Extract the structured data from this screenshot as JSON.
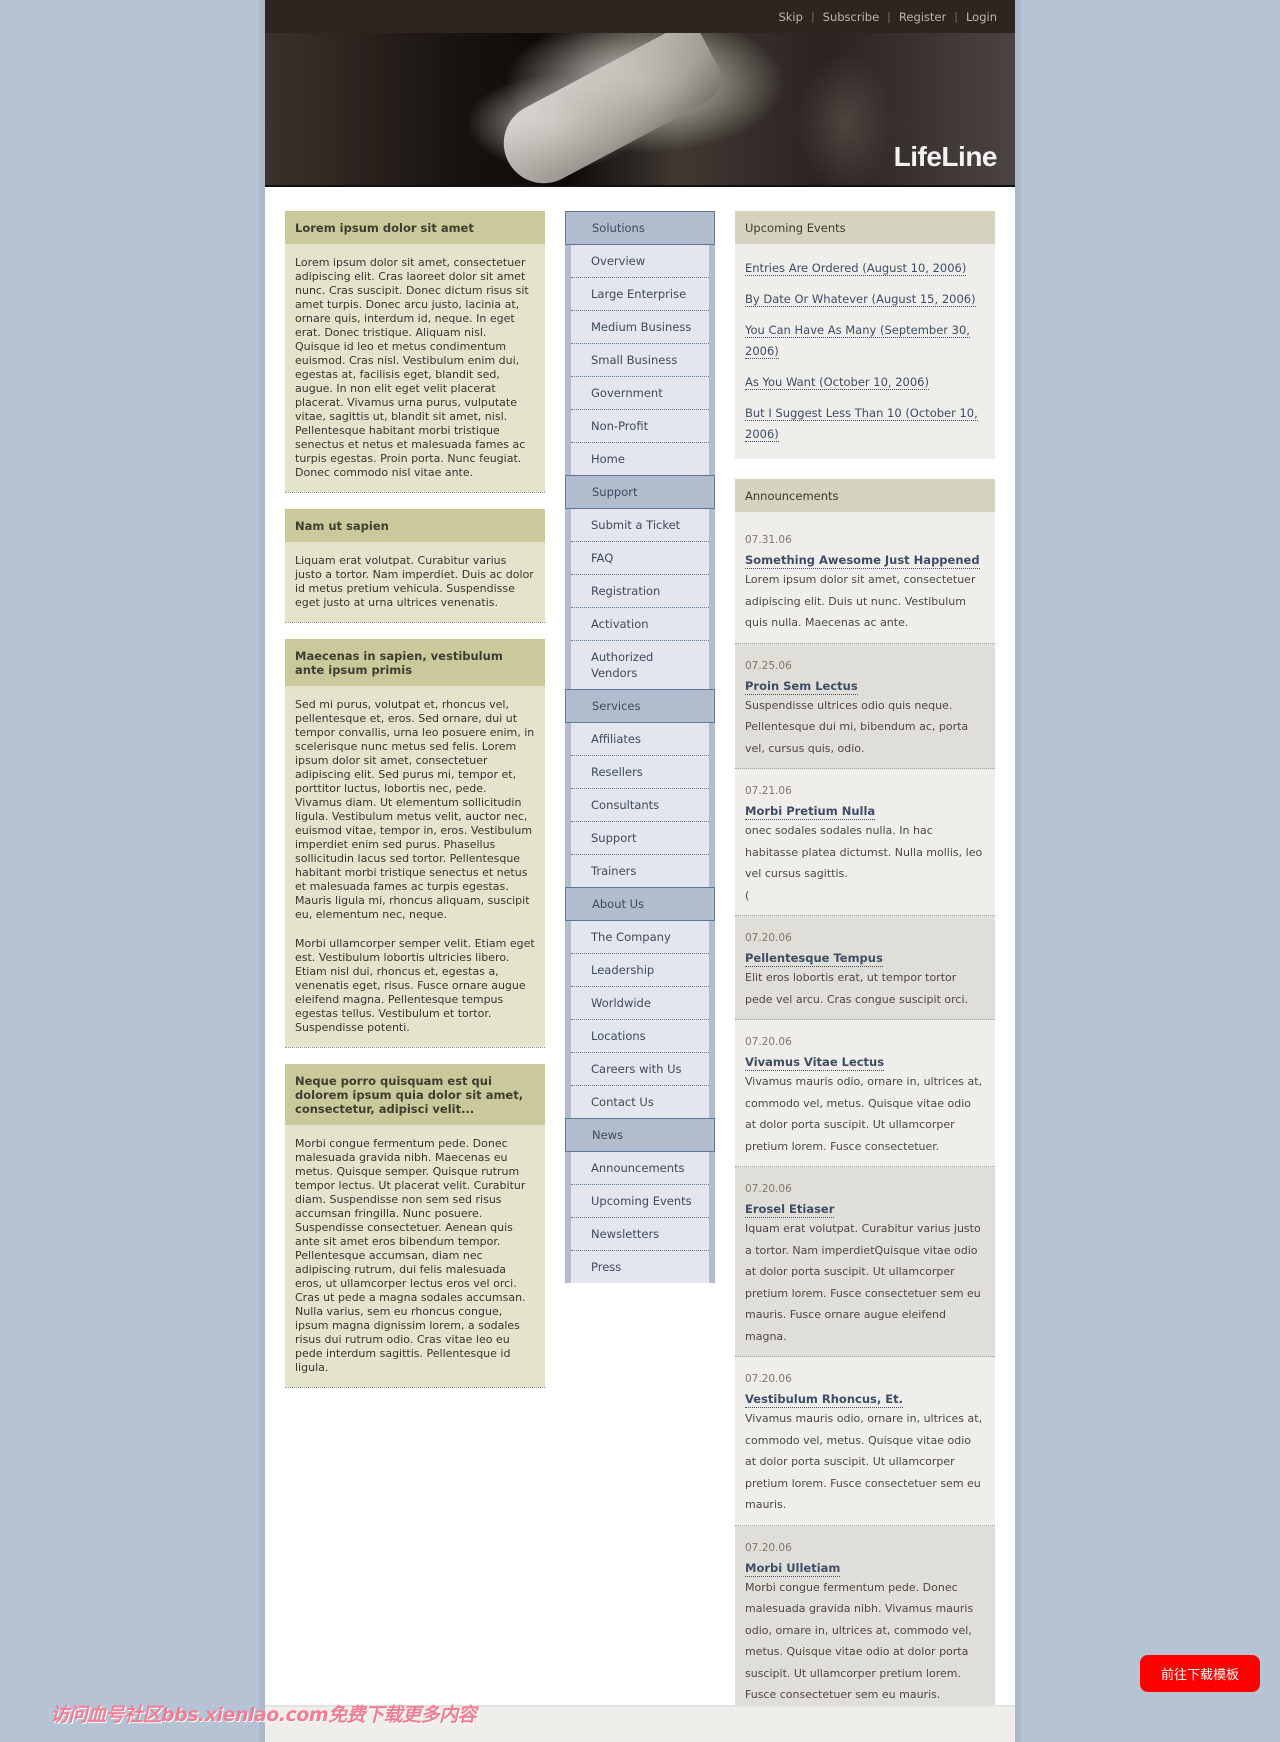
{
  "topbar": {
    "links": [
      "Skip",
      "Subscribe",
      "Register",
      "Login"
    ]
  },
  "banner": {
    "title": "LifeLine"
  },
  "left_boxes": [
    {
      "title": "Lorem ipsum dolor sit amet",
      "paragraphs": [
        "Lorem ipsum dolor sit amet, consectetuer adipiscing elit. Cras laoreet dolor sit amet nunc. Cras suscipit. Donec dictum risus sit amet turpis. Donec arcu justo, lacinia at, ornare quis, interdum id, neque. In eget erat. Donec tristique. Aliquam nisl. Quisque id leo et metus condimentum euismod. Cras nisl. Vestibulum enim dui, egestas at, facilisis eget, blandit sed, augue. In non elit eget velit placerat placerat. Vivamus urna purus, vulputate vitae, sagittis ut, blandit sit amet, nisl. Pellentesque habitant morbi tristique senectus et netus et malesuada fames ac turpis egestas. Proin porta. Nunc feugiat. Donec commodo nisl vitae ante."
      ]
    },
    {
      "title": "Nam ut sapien",
      "paragraphs": [
        "Liquam erat volutpat. Curabitur varius justo a tortor. Nam imperdiet. Duis ac dolor id metus pretium vehicula. Suspendisse eget justo at urna ultrices venenatis."
      ]
    },
    {
      "title": "Maecenas in sapien, vestibulum ante ipsum primis",
      "paragraphs": [
        "Sed mi purus, volutpat et, rhoncus vel, pellentesque et, eros. Sed ornare, dui ut tempor convallis, urna leo posuere enim, in scelerisque nunc metus sed felis. Lorem ipsum dolor sit amet, consectetuer adipiscing elit. Sed purus mi, tempor et, porttitor luctus, lobortis nec, pede. Vivamus diam. Ut elementum sollicitudin ligula. Vestibulum metus velit, auctor nec, euismod vitae, tempor in, eros. Vestibulum imperdiet enim sed purus. Phasellus sollicitudin lacus sed tortor. Pellentesque habitant morbi tristique senectus et netus et malesuada fames ac turpis egestas. Mauris ligula mi, rhoncus aliquam, suscipit eu, elementum nec, neque.",
        "Morbi ullamcorper semper velit. Etiam eget est. Vestibulum lobortis ultricies libero. Etiam nisl dui, rhoncus et, egestas a, venenatis eget, risus. Fusce ornare augue eleifend magna. Pellentesque tempus egestas tellus. Vestibulum et tortor. Suspendisse potenti."
      ]
    },
    {
      "title": "Neque porro quisquam est qui dolorem ipsum quia dolor sit amet, consectetur, adipisci velit...",
      "paragraphs": [
        "Morbi congue fermentum pede. Donec malesuada gravida nibh. Maecenas eu metus. Quisque semper. Quisque rutrum tempor lectus. Ut placerat velit. Curabitur diam. Suspendisse non sem sed risus accumsan fringilla. Nunc posuere. Suspendisse consectetuer. Aenean quis ante sit amet eros bibendum tempor. Pellentesque accumsan, diam nec adipiscing rutrum, dui felis malesuada eros, ut ullamcorper lectus eros vel orci. Cras ut pede a magna sodales accumsan. Nulla varius, sem eu rhoncus congue, ipsum magna dignissim lorem, a sodales risus dui rutrum odio. Cras vitae leo eu pede interdum sagittis. Pellentesque id ligula."
      ]
    }
  ],
  "nav": [
    {
      "section": "Solutions",
      "items": [
        "Overview",
        "Large Enterprise",
        "Medium Business",
        "Small Business",
        "Government",
        "Non-Profit",
        "Home"
      ]
    },
    {
      "section": "Support",
      "items": [
        "Submit a Ticket",
        "FAQ",
        "Registration",
        "Activation",
        "Authorized Vendors"
      ]
    },
    {
      "section": "Services",
      "items": [
        "Affiliates",
        "Resellers",
        "Consultants",
        "Support",
        "Trainers"
      ]
    },
    {
      "section": "About Us",
      "items": [
        "The Company",
        "Leadership",
        "Worldwide",
        "Locations",
        "Careers with Us",
        "Contact Us"
      ]
    },
    {
      "section": "News",
      "items": [
        "Announcements",
        "Upcoming Events",
        "Newsletters",
        "Press"
      ]
    }
  ],
  "upcoming_events": {
    "title": "Upcoming Events",
    "items": [
      "Entries Are Ordered (August 10, 2006)",
      "By Date Or Whatever (August 15, 2006)",
      "You Can Have As Many (September 30, 2006)",
      "As You Want (October 10, 2006)",
      "But I Suggest Less Than 10 (October 10, 2006)"
    ]
  },
  "announcements": {
    "title": "Announcements",
    "items": [
      {
        "date": "07.31.06",
        "title": "Something Awesome Just Happened",
        "text": "Lorem ipsum dolor sit amet, consectetuer adipiscing elit. Duis ut nunc. Vestibulum quis nulla. Maecenas ac ante."
      },
      {
        "date": "07.25.06",
        "title": "Proin Sem Lectus",
        "text": "Suspendisse ultrices odio quis neque. Pellentesque dui mi, bibendum ac, porta vel, cursus quis, odio."
      },
      {
        "date": "07.21.06",
        "title": "Morbi Pretium Nulla",
        "text": "onec sodales sodales nulla. In hac habitasse platea dictumst. Nulla mollis, leo vel cursus sagittis.",
        "extra": "("
      },
      {
        "date": "07.20.06",
        "title": "Pellentesque Tempus",
        "text": "Elit eros lobortis erat, ut tempor tortor pede vel arcu. Cras congue suscipit orci."
      },
      {
        "date": "07.20.06",
        "title": "Vivamus Vitae Lectus",
        "text": "Vivamus mauris odio, ornare in, ultrices at, commodo vel, metus. Quisque vitae odio at dolor porta suscipit. Ut ullamcorper pretium lorem. Fusce consectetuer."
      },
      {
        "date": "07.20.06",
        "title": "Erosel Etiaser",
        "text": "Iquam erat volutpat. Curabitur varius justo a tortor. Nam imperdietQuisque vitae odio at dolor porta suscipit. Ut ullamcorper pretium lorem. Fusce consectetuer sem eu mauris. Fusce ornare augue eleifend magna."
      },
      {
        "date": "07.20.06",
        "title": "Vestibulum Rhoncus, Et.",
        "text": "Vivamus mauris odio, ornare in, ultrices at, commodo vel, metus. Quisque vitae odio at dolor porta suscipit. Ut ullamcorper pretium lorem. Fusce consectetuer sem eu mauris."
      },
      {
        "date": "07.20.06",
        "title": "Morbi Ulletiam",
        "text": "Morbi congue fermentum pede. Donec malesuada gravida nibh. Vivamus mauris odio, ornare in, ultrices at, commodo vel, metus. Quisque vitae odio at dolor porta suscipit. Ut ullamcorper pretium lorem. Fusce consectetuer sem eu mauris."
      }
    ]
  },
  "watermark": "访问血号社区bbs.xienlao.com免费下载更多内容",
  "download_button": "前往下载模板",
  "colors": {
    "page_bg": "#b6c3d4",
    "topbar_bg": "#2e2420",
    "left_box_head": "#c9c99b",
    "left_box_body": "#e4e4cc",
    "nav_section": "#b1bccf",
    "nav_item_bg": "#e3e6ef",
    "right_box_head": "#d5d3bf",
    "link": "#3e4d66",
    "download_button": "#ff0000"
  }
}
